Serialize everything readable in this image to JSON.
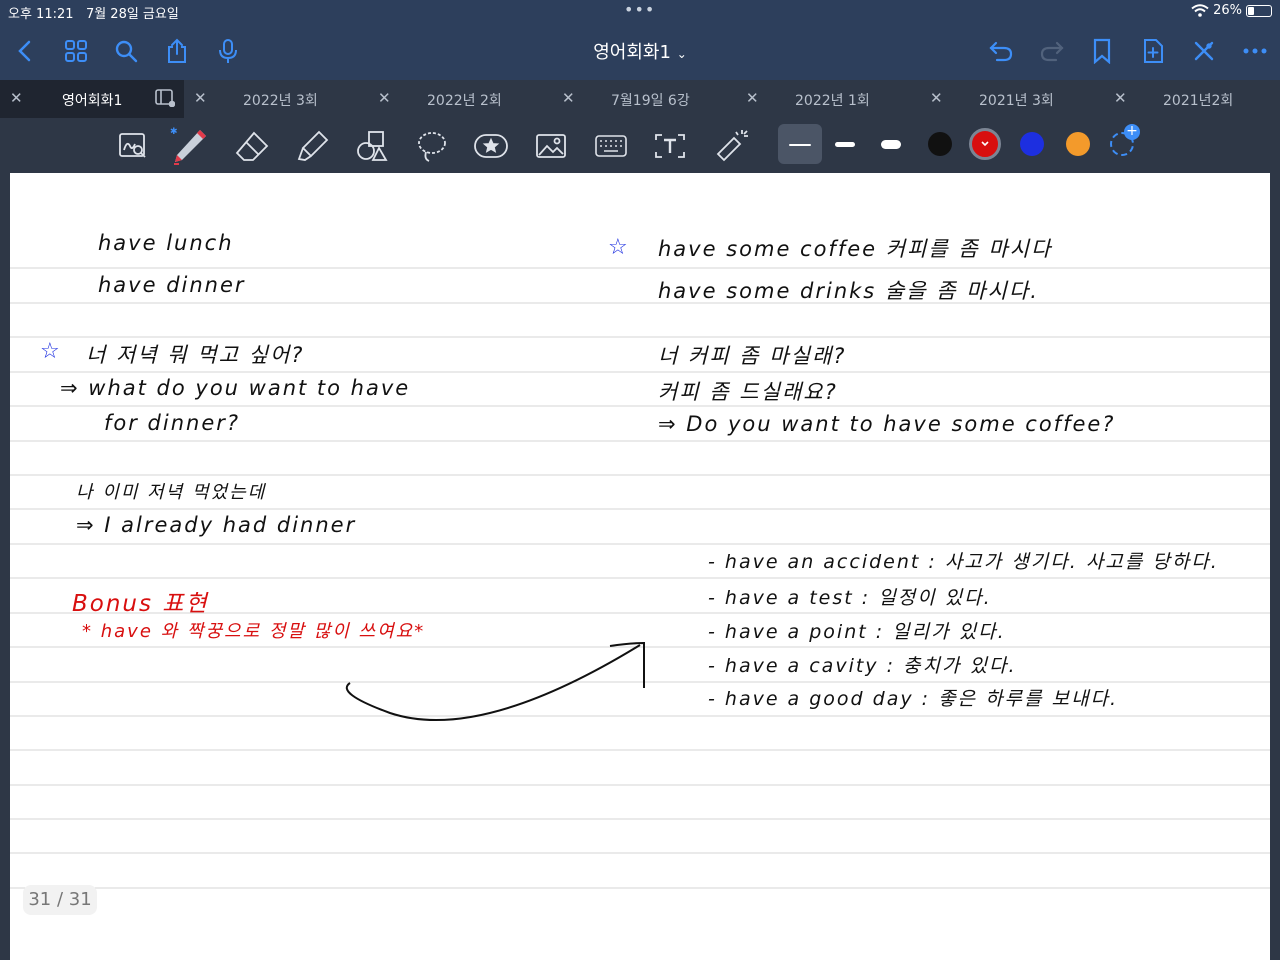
{
  "status": {
    "time": "오후 11:21",
    "date": "7월 28일 금요일",
    "battery_text": "26%",
    "battery_level": 0.26
  },
  "nav": {
    "title": "영어회화1",
    "icons": [
      "back-chevron-icon",
      "grid-icon",
      "search-icon",
      "share-icon",
      "microphone-icon",
      "undo-icon",
      "redo-icon",
      "bookmark-icon",
      "add-page-icon",
      "close-x-icon",
      "more-icon"
    ]
  },
  "tabs": [
    {
      "label": "영어회화1",
      "active": true
    },
    {
      "label": "2022년 3회",
      "active": false
    },
    {
      "label": "2022년 2회",
      "active": false
    },
    {
      "label": "7월19일 6강",
      "active": false
    },
    {
      "label": "2022년 1회",
      "active": false
    },
    {
      "label": "2021년 3회",
      "active": false
    },
    {
      "label": "2021년2회",
      "active": false
    }
  ],
  "toolbar": {
    "tools": [
      "zoom-tool-icon",
      "pen-tool-icon",
      "eraser-tool-icon",
      "highlighter-tool-icon",
      "shapes-tool-icon",
      "lasso-tool-icon",
      "sticker-tool-icon",
      "image-tool-icon",
      "keyboard-tool-icon",
      "text-tool-icon",
      "laser-pointer-icon"
    ],
    "colors": [
      "#111111",
      "#d80f0f",
      "#1d2fe0",
      "#f39a2b"
    ],
    "selected_color": "#d80f0f",
    "pen_color": "#e23a4a"
  },
  "note": {
    "left": {
      "l1": "have lunch",
      "l2": "have dinner",
      "marker": "☆",
      "q_kr": "너 저녁 뭐 먹고 싶어?",
      "q_en1": "⇒ what do you want to have",
      "q_en2": "for dinner?",
      "a_kr": "나 이미 저녁 먹었는데",
      "a_en": "⇒ I already had dinner",
      "bonus_title": "Bonus 표현",
      "bonus_note": "* have 와 짝꿍으로 정말 많이 쓰여요*"
    },
    "right": {
      "marker": "☆",
      "r1": "have some coffee 커피를 좀 마시다",
      "r2": "have some drinks 술을 좀 마시다.",
      "q_kr1": "너 커피 좀 마실래?",
      "q_kr2": "커피 좀 드실래요?",
      "q_en": "⇒ Do you want to have some coffee?",
      "bonus_items": [
        "- have an accident : 사고가 생기다. 사고를 당하다.",
        "- have a test : 일정이 있다.",
        "- have a point : 일리가 있다.",
        "- have a cavity : 충치가 있다.",
        "- have a good day : 좋은 하루를 보내다."
      ]
    }
  },
  "page_indicator": "31 / 31"
}
